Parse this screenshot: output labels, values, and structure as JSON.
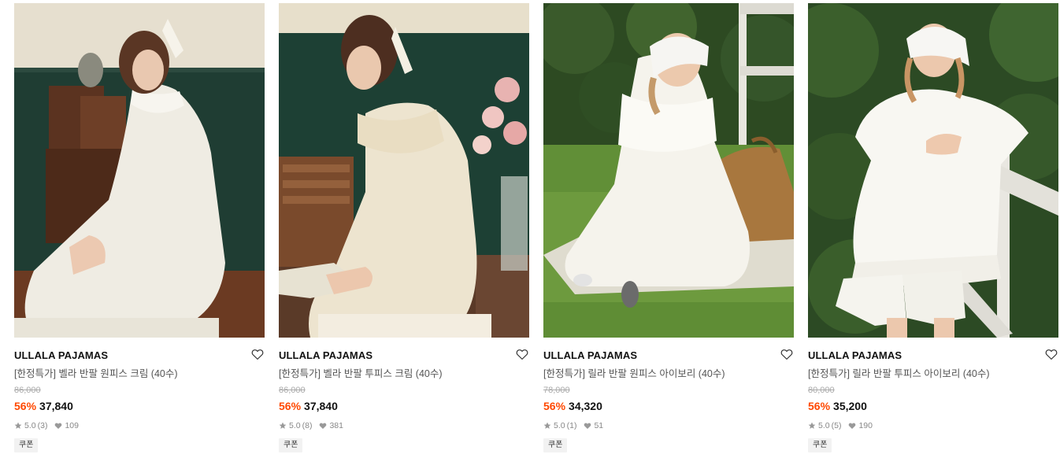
{
  "products": [
    {
      "brand": "ULLALA PAJAMAS",
      "name": "[한정특가] 벨라 반팔 원피스 크림 (40수)",
      "original_price": "86,000",
      "discount_rate": "56%",
      "sale_price": "37,840",
      "rating": "5.0",
      "review_count": "(3)",
      "like_count": "109",
      "badge": "쿠폰"
    },
    {
      "brand": "ULLALA PAJAMAS",
      "name": "[한정특가] 벨라 반팔 투피스 크림 (40수)",
      "original_price": "86,000",
      "discount_rate": "56%",
      "sale_price": "37,840",
      "rating": "5.0",
      "review_count": "(8)",
      "like_count": "381",
      "badge": "쿠폰"
    },
    {
      "brand": "ULLALA PAJAMAS",
      "name": "[한정특가] 릴라 반팔 원피스 아이보리 (40수)",
      "original_price": "78,000",
      "discount_rate": "56%",
      "sale_price": "34,320",
      "rating": "5.0",
      "review_count": "(1)",
      "like_count": "51",
      "badge": "쿠폰"
    },
    {
      "brand": "ULLALA PAJAMAS",
      "name": "[한정특가] 릴라 반팔 투피스 아이보리 (40수)",
      "original_price": "80,000",
      "discount_rate": "56%",
      "sale_price": "35,200",
      "rating": "5.0",
      "review_count": "(5)",
      "like_count": "190",
      "badge": "쿠폰"
    }
  ],
  "colors": {
    "discount": "#ff4800",
    "brand_text": "#111111",
    "muted": "#888888",
    "badge_bg": "#f2f2f2"
  },
  "icons": {
    "wishlist": "heart-outline-icon",
    "rating": "star-icon",
    "likes": "heart-filled-icon"
  }
}
